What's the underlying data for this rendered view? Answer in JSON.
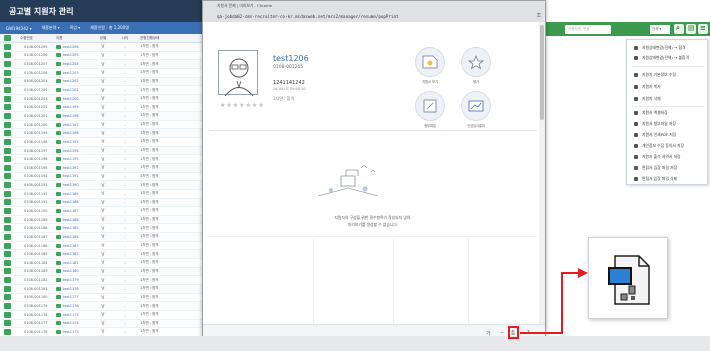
{
  "left_app": {
    "title": "공고별 지원자 관리",
    "filters": [
      "GW194242 ▾",
      "채용분야 ▾",
      "직업 ▾",
      "채용인원 : 총 1,200명"
    ],
    "columns": [
      "✓",
      "수험번호",
      "이름",
      "성별",
      "나이",
      "전형진행상태"
    ],
    "rows": [
      {
        "id": "0108-001205",
        "name": "test1206",
        "gender": "남",
        "age": "-",
        "status": "1차면 : 합격"
      },
      {
        "id": "0108-001206",
        "name": "test1205",
        "gender": "남",
        "age": "-",
        "status": "1차면 : 합격"
      },
      {
        "id": "0108-001207",
        "name": "test1204",
        "gender": "남",
        "age": "-",
        "status": "1차면 : 합격"
      },
      {
        "id": "0108-001208",
        "name": "test1203",
        "gender": "남",
        "age": "-",
        "status": "1차면 : 합격"
      },
      {
        "id": "0108-001201",
        "name": "test1202",
        "gender": "남",
        "age": "-",
        "status": "1차면 : 합격"
      },
      {
        "id": "0108-001204",
        "name": "test1201",
        "gender": "남",
        "age": "-",
        "status": "1차면 : 합격"
      },
      {
        "id": "0108-001203",
        "name": "test1200",
        "gender": "남",
        "age": "-",
        "status": "1차면 : 합격"
      },
      {
        "id": "0108-001202",
        "name": "test1199",
        "gender": "남",
        "age": "-",
        "status": "1차면 : 합격"
      },
      {
        "id": "0108-001201",
        "name": "test1198",
        "gender": "남",
        "age": "-",
        "status": "1차면 : 합격"
      },
      {
        "id": "0108-001200",
        "name": "test1197",
        "gender": "남",
        "age": "-",
        "status": "1차면 : 합격"
      },
      {
        "id": "0108-001199",
        "name": "test1196",
        "gender": "남",
        "age": "-",
        "status": "1차면 : 합격"
      },
      {
        "id": "0108-001198",
        "name": "test1195",
        "gender": "남",
        "age": "-",
        "status": "1차면 : 합격"
      },
      {
        "id": "0108-001197",
        "name": "test1194",
        "gender": "남",
        "age": "-",
        "status": "1차면 : 합격"
      },
      {
        "id": "0108-001196",
        "name": "test1193",
        "gender": "남",
        "age": "-",
        "status": "1차면 : 합격"
      },
      {
        "id": "0108-001195",
        "name": "test1192",
        "gender": "남",
        "age": "-",
        "status": "1차면 : 합격"
      },
      {
        "id": "0108-001194",
        "name": "test1191",
        "gender": "남",
        "age": "-",
        "status": "1차면 : 합격"
      },
      {
        "id": "0108-001193",
        "name": "test1190",
        "gender": "남",
        "age": "-",
        "status": "1차면 : 합격"
      },
      {
        "id": "0108-001192",
        "name": "test1189",
        "gender": "남",
        "age": "-",
        "status": "1차면 : 합격"
      },
      {
        "id": "0108-001191",
        "name": "test1188",
        "gender": "남",
        "age": "-",
        "status": "1차면 : 합격"
      },
      {
        "id": "0108-001190",
        "name": "test1187",
        "gender": "남",
        "age": "-",
        "status": "1차면 : 합격"
      },
      {
        "id": "0108-001189",
        "name": "test1186",
        "gender": "남",
        "age": "-",
        "status": "1차면 : 합격"
      },
      {
        "id": "0108-001188",
        "name": "test1185",
        "gender": "남",
        "age": "-",
        "status": "1차면 : 합격"
      },
      {
        "id": "0108-001187",
        "name": "test1184",
        "gender": "남",
        "age": "-",
        "status": "1차면 : 합격"
      },
      {
        "id": "0108-001186",
        "name": "test1183",
        "gender": "남",
        "age": "-",
        "status": "1차면 : 합격"
      },
      {
        "id": "0108-001185",
        "name": "test1182",
        "gender": "남",
        "age": "-",
        "status": "1차면 : 합격"
      },
      {
        "id": "0108-001184",
        "name": "test1181",
        "gender": "남",
        "age": "-",
        "status": "1차면 : 합격"
      },
      {
        "id": "0108-001183",
        "name": "test1180",
        "gender": "남",
        "age": "-",
        "status": "1차면 : 합격"
      },
      {
        "id": "0108-001182",
        "name": "test1179",
        "gender": "남",
        "age": "-",
        "status": "1차면 : 합격"
      },
      {
        "id": "0108-001181",
        "name": "test1178",
        "gender": "남",
        "age": "-",
        "status": "1차면 : 합격"
      },
      {
        "id": "0108-001180",
        "name": "test1177",
        "gender": "남",
        "age": "-",
        "status": "1차면 : 합격"
      },
      {
        "id": "0108-001179",
        "name": "test1176",
        "gender": "남",
        "age": "-",
        "status": "1차면 : 합격"
      },
      {
        "id": "0108-001178",
        "name": "test1175",
        "gender": "남",
        "age": "-",
        "status": "1차면 : 합격"
      },
      {
        "id": "0108-001177",
        "name": "test1174",
        "gender": "남",
        "age": "-",
        "status": "1차면 : 합격"
      },
      {
        "id": "0108-001176",
        "name": "test1173",
        "gender": "남",
        "age": "-",
        "status": "1차면 : 합격"
      }
    ]
  },
  "popup": {
    "window_title": "지원서 문제 | 미리보기 - Chrome",
    "url": "qa-jobda02-cms-recruiter-co-kr.midasweb.net/mrs2/manager/resume/popPrint",
    "candidate": {
      "name": "test1206",
      "code": "0108-001205",
      "phone": "1241141242",
      "date": "26-04-07 09:05:50",
      "job": "1차면 : 합격",
      "stars": "★★★★★★★"
    },
    "actions": [
      "지원서 보기",
      "평가",
      "첨부파일",
      "인성검사결과"
    ],
    "empty_message_line1": "지원자의 구성을 위한 필수항목이 작성되지 않아,",
    "empty_message_line2": "미리보기를 생성할 수 없습니다.",
    "footer": {
      "zoom": "가",
      "minus": "−",
      "print": "⎙",
      "help": "?"
    }
  },
  "right_app": {
    "search_placeholder": "지원자명, 번호",
    "select_value": "전체 ▾",
    "menu_items": [
      {
        "label": "지원상태변경(전체) → 합격",
        "icon": "arrow-right-icon"
      },
      {
        "label": "지원상태변경(전체) → 불합격",
        "icon": "arrow-right-icon"
      },
      {
        "label": "지원자 기본정보 수정",
        "icon": "pencil-icon"
      },
      {
        "label": "지원자 복사",
        "icon": "copy-icon"
      },
      {
        "label": "지원자 삭제",
        "icon": "trash-icon"
      },
      {
        "label": "지원서 엑셀저장",
        "icon": "excel-icon"
      },
      {
        "label": "지원서 첨부파일 저장",
        "icon": "paperclip-icon"
      },
      {
        "label": "지원서 인쇄PDF 저장",
        "icon": "pdf-icon"
      },
      {
        "label": "개인정보 수집 동의서 저장",
        "icon": "document-icon"
      },
      {
        "label": "지원자 출석 서약서 저장",
        "icon": "document-icon"
      },
      {
        "label": "면접서 입장 파일 저장",
        "icon": "document-icon"
      },
      {
        "label": "면접서 입장 파일 삭제",
        "icon": "trash-icon"
      }
    ]
  },
  "colors": {
    "accent_red": "#e21f1f",
    "brand_navy": "#263b56",
    "brand_blue": "#3b6fb5",
    "brand_green": "#3c9a4c"
  }
}
